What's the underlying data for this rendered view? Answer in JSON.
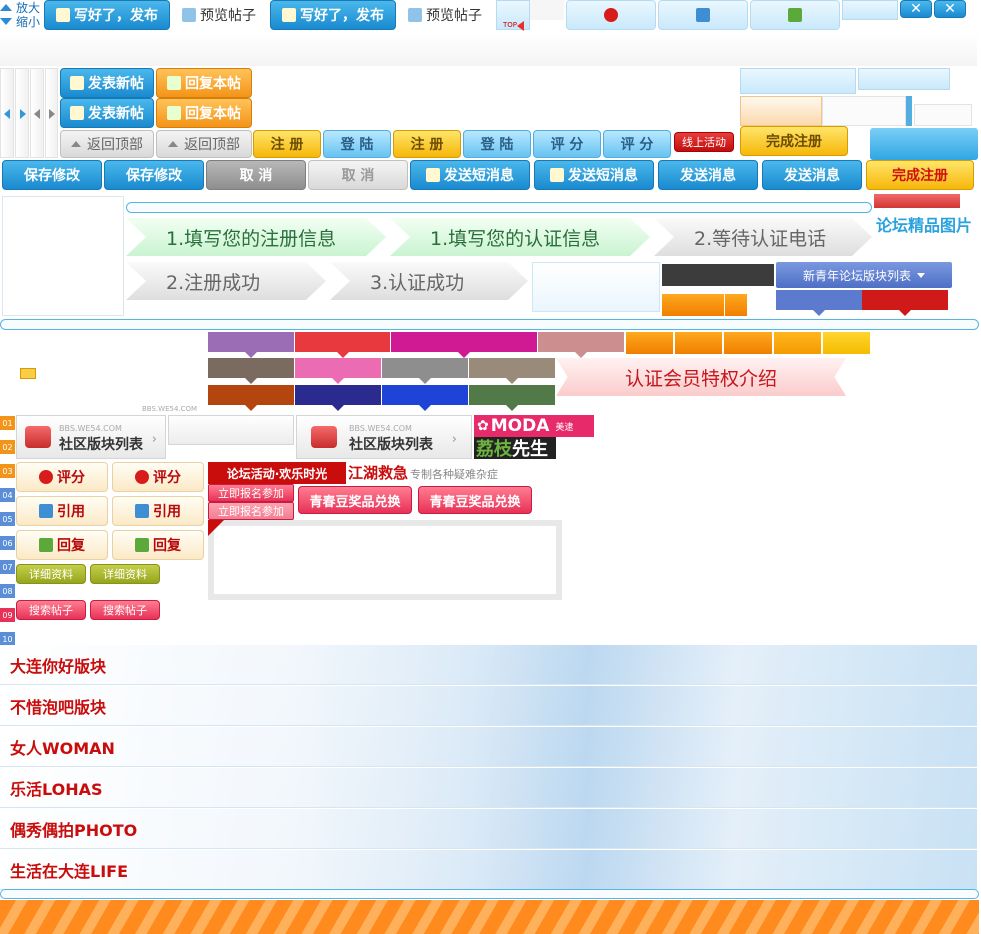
{
  "toolbar": {
    "zoom_in": "放大",
    "zoom_out": "缩小",
    "publish": "写好了，发布",
    "preview": "预览帖子",
    "top": "TOP"
  },
  "post_buttons": {
    "new_thread": "发表新帖",
    "reply_thread": "回复本帖",
    "back_top": "返回顶部"
  },
  "auth_buttons": {
    "register": "注 册",
    "login": "登 陆",
    "rate": "评 分",
    "online_activity": "线上活动",
    "finish_register": "完成注册"
  },
  "action_bar": {
    "save_changes": "保存修改",
    "cancel": "取 消",
    "send_sms": "发送短消息",
    "send_msg": "发送消息",
    "finish_register": "完成注册"
  },
  "steps": {
    "row1": [
      "1.填写您的注册信息",
      "1.填写您的认证信息",
      "2.等待认证电话"
    ],
    "row2": [
      "2.注册成功",
      "3.认证成功"
    ]
  },
  "side_title": "论坛精品图片",
  "forum_list_dropdown": "新青年论坛版块列表",
  "member_banner": "认证会员特权介绍",
  "watermark": "BBS.WE54.COM",
  "community_list": "社区版块列表",
  "moda": {
    "brand": "MODA",
    "badge": "美逮",
    "sub1": "荔枝",
    "sub2": "先生"
  },
  "small_buttons": {
    "rate": "评分",
    "quote": "引用",
    "reply": "回复",
    "detail": "详细资料",
    "search": "搜索帖子"
  },
  "activity": {
    "title": "论坛活动·欢乐时光",
    "jianghu": "江湖救急",
    "jianghu_sub": "专制各种疑难杂症",
    "signup": "立即报名参加",
    "exchange": "青春豆奖品兑换"
  },
  "numbers": [
    "01",
    "02",
    "03",
    "04",
    "05",
    "06",
    "07",
    "08",
    "09",
    "10"
  ],
  "forums": [
    "大连你好版块",
    "不惜泡吧版块",
    "女人WOMAN",
    "乐活LOHAS",
    "偶秀偶拍PHOTO",
    "生活在大连LIFE"
  ]
}
